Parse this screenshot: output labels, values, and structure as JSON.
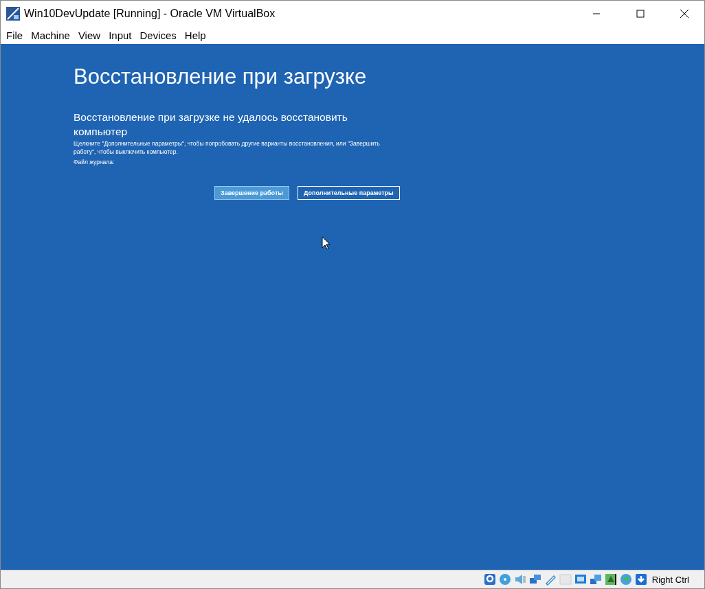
{
  "window": {
    "title": "Win10DevUpdate [Running] - Oracle VM VirtualBox"
  },
  "menu": [
    "File",
    "Machine",
    "View",
    "Input",
    "Devices",
    "Help"
  ],
  "screen": {
    "heading": "Восстановление при загрузке",
    "message": "Восстановление при загрузке не удалось восстановить компьютер",
    "hint": "Щелкните \"Дополнительные параметры\", чтобы попробовать другие варианты восстановления, или \"Завершить работу\", чтобы выключить компьютер.",
    "log_label": "Файл журнала:",
    "buttons": [
      {
        "label": "Завершение работы",
        "selected": true
      },
      {
        "label": "Дополнительные параметры",
        "selected": false
      }
    ]
  },
  "status_bar": {
    "host_key": "Right Ctrl"
  }
}
